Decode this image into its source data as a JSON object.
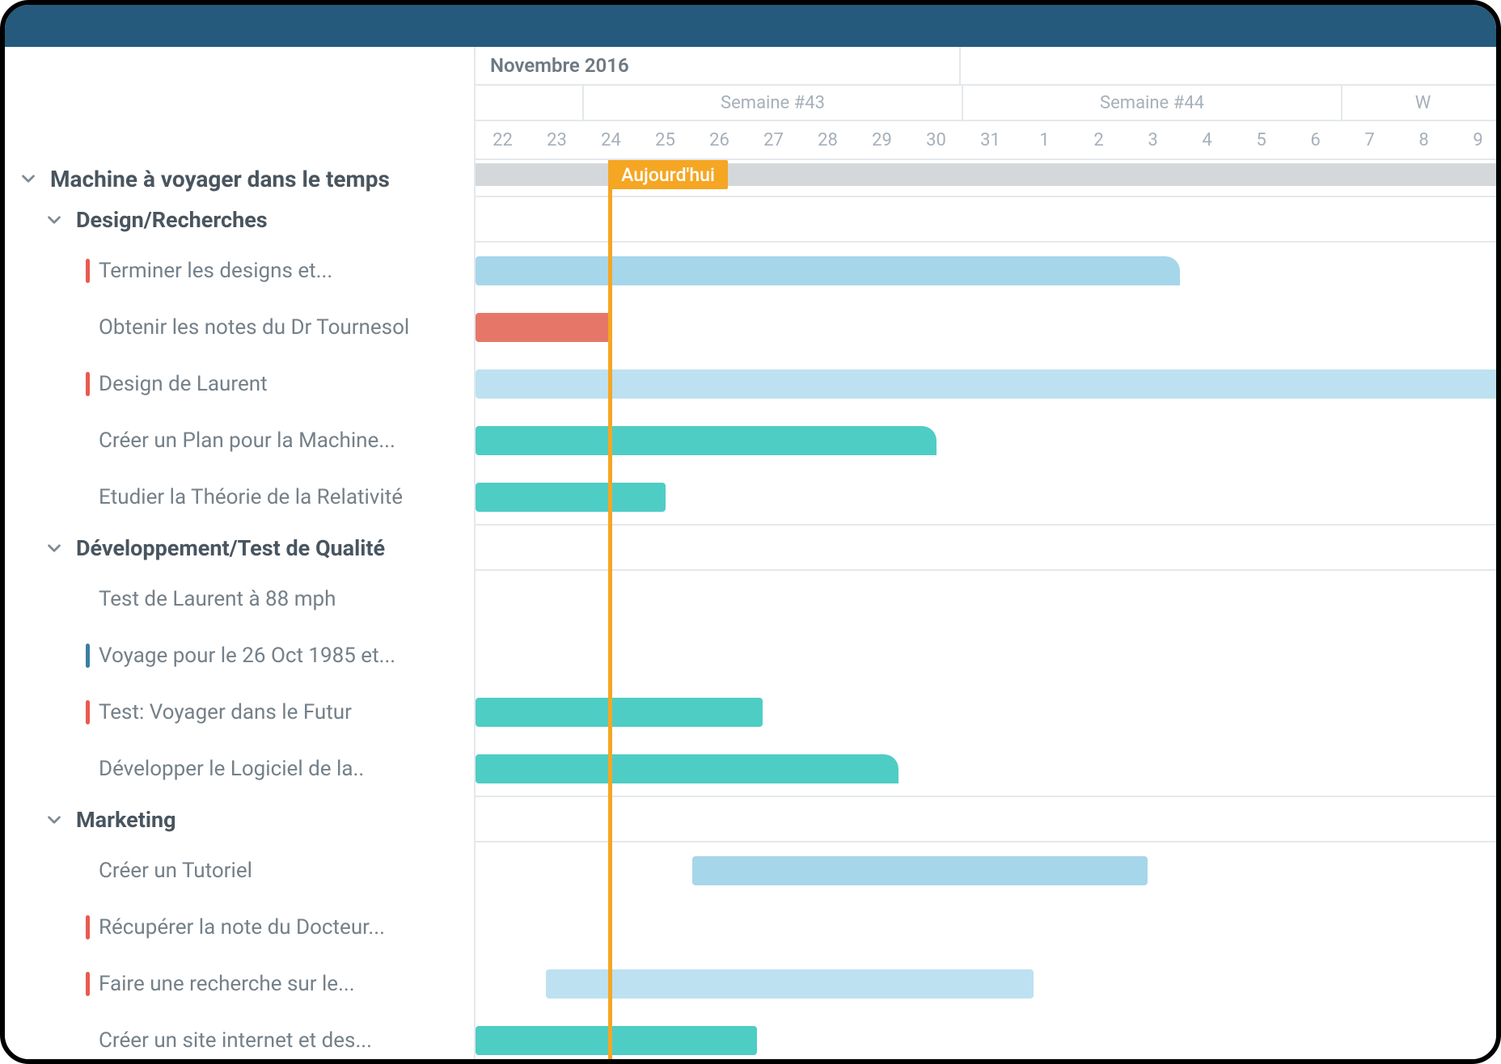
{
  "colors": {
    "topbar": "#255a7d",
    "today": "#f5a623",
    "bar_blue": "#a6d6ea",
    "bar_blue_light": "#bde1f0",
    "bar_red": "#e67768",
    "bar_teal": "#4ecdc4",
    "flag_red": "#e85a4f",
    "flag_blue": "#3b7ea1"
  },
  "timeline": {
    "month_label": "Novembre 2016",
    "today_label": "Aujourd'hui",
    "today_day": 24,
    "day_width": 67,
    "first_visible_day": 22,
    "days": [
      22,
      23,
      24,
      25,
      26,
      27,
      28,
      29,
      30,
      31,
      1,
      2,
      3,
      4,
      5,
      6,
      7,
      8,
      9
    ],
    "weeks": [
      {
        "label": "Semaine #43",
        "start_day_index": 2,
        "span_days": 7
      },
      {
        "label": "Semaine #44",
        "start_day_index": 9,
        "span_days": 7
      },
      {
        "label": "W",
        "start_day_index": 16,
        "span_days": 3
      }
    ]
  },
  "sidebar": {
    "project": "Machine à voyager dans le temps",
    "groups": [
      {
        "name": "Design/Recherches",
        "tasks": [
          {
            "label": "Terminer les designs et...",
            "flag": "red"
          },
          {
            "label": "Obtenir les notes du Dr Tournesol",
            "flag": null
          },
          {
            "label": "Design de Laurent",
            "flag": "red"
          },
          {
            "label": "Créer un Plan pour la Machine...",
            "flag": null
          },
          {
            "label": "Etudier la Théorie de la Relativité",
            "flag": null
          }
        ]
      },
      {
        "name": "Développement/Test de Qualité",
        "tasks": [
          {
            "label": "Test de Laurent à 88 mph",
            "flag": null
          },
          {
            "label": "Voyage pour le 26 Oct 1985 et...",
            "flag": "blue"
          },
          {
            "label": "Test: Voyager dans le Futur",
            "flag": "red"
          },
          {
            "label": "Développer le Logiciel de la..",
            "flag": null
          }
        ]
      },
      {
        "name": "Marketing",
        "tasks": [
          {
            "label": "Créer un Tutoriel",
            "flag": null
          },
          {
            "label": "Récupérer la note du Docteur...",
            "flag": "red"
          },
          {
            "label": "Faire une recherche sur le...",
            "flag": "red"
          },
          {
            "label": "Créer un site internet et des...",
            "flag": null
          }
        ]
      }
    ]
  },
  "chart_data": {
    "type": "bar",
    "orientation": "horizontal-gantt",
    "x_axis": "calendar days starting Oct 22 2016",
    "bars": [
      {
        "task": "Terminer les designs et...",
        "start": 22,
        "end": 35,
        "color": "lightblue",
        "end_shape": "arrow"
      },
      {
        "task": "Obtenir les notes du Dr Tournesol",
        "start": 22,
        "end": 24.5,
        "color": "red"
      },
      {
        "task": "Design de Laurent",
        "start": 22,
        "end": 41,
        "color": "lighterblue"
      },
      {
        "task": "Créer un Plan pour la Machine...",
        "start": 22,
        "end": 30.5,
        "color": "teal",
        "end_shape": "arrow"
      },
      {
        "task": "Etudier la Théorie de la Relativité",
        "start": 22,
        "end": 25.5,
        "color": "teal"
      },
      {
        "task": "Test de Laurent à 88 mph",
        "start": null,
        "end": null,
        "color": null
      },
      {
        "task": "Voyage pour le 26 Oct 1985 et...",
        "start": null,
        "end": null,
        "color": null
      },
      {
        "task": "Test: Voyager dans le Futur",
        "start": 22,
        "end": 27.3,
        "color": "teal"
      },
      {
        "task": "Développer le Logiciel de la..",
        "start": 22,
        "end": 29.8,
        "color": "teal",
        "end_shape": "arrow"
      },
      {
        "task": "Créer un Tutoriel",
        "start": 26,
        "end": 34.4,
        "color": "lightblue"
      },
      {
        "task": "Récupérer la note du Docteur...",
        "start": null,
        "end": null,
        "color": null
      },
      {
        "task": "Faire une recherche sur le...",
        "start": 23.3,
        "end": 32.3,
        "color": "lighterblue"
      },
      {
        "task": "Créer un site internet et des...",
        "start": 22,
        "end": 27.2,
        "color": "teal"
      }
    ]
  }
}
